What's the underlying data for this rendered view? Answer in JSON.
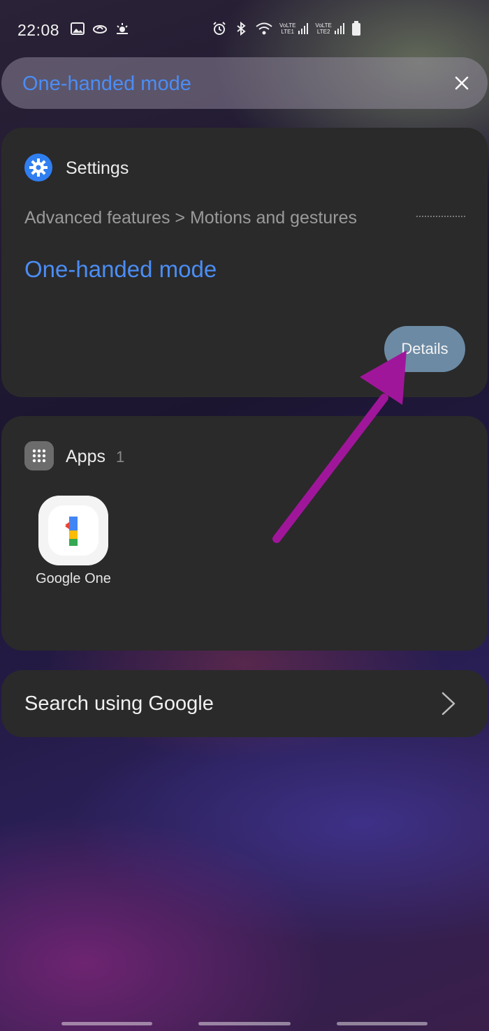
{
  "status_bar": {
    "time": "22:08",
    "left_icons": [
      "gallery-icon",
      "sync-icon",
      "weather-icon"
    ],
    "right_icons": [
      "alarm-icon",
      "bluetooth-icon",
      "wifi-icon",
      "signal-lte1-icon",
      "signal-lte2-icon",
      "battery-icon"
    ],
    "lte1_label": "LTE1",
    "lte2_label": "LTE2",
    "volte_label": "VoLTE"
  },
  "search": {
    "query": "One-handed mode",
    "clear_icon": "close-icon"
  },
  "settings_card": {
    "app_name": "Settings",
    "path": "Advanced features > Motions and gestures",
    "result_title": "One-handed mode",
    "details_label": "Details"
  },
  "apps_card": {
    "title": "Apps",
    "count": "1",
    "apps": [
      {
        "label": "Google One"
      }
    ]
  },
  "google_card": {
    "label": "Search using Google"
  },
  "colors": {
    "accent_blue": "#4b8df5",
    "card_bg": "#2a2a2a",
    "details_button": "#6c8aa4",
    "annotation_arrow": "#a0169a"
  },
  "annotation": {
    "arrow_icon": "arrow-pointer-annotation"
  }
}
